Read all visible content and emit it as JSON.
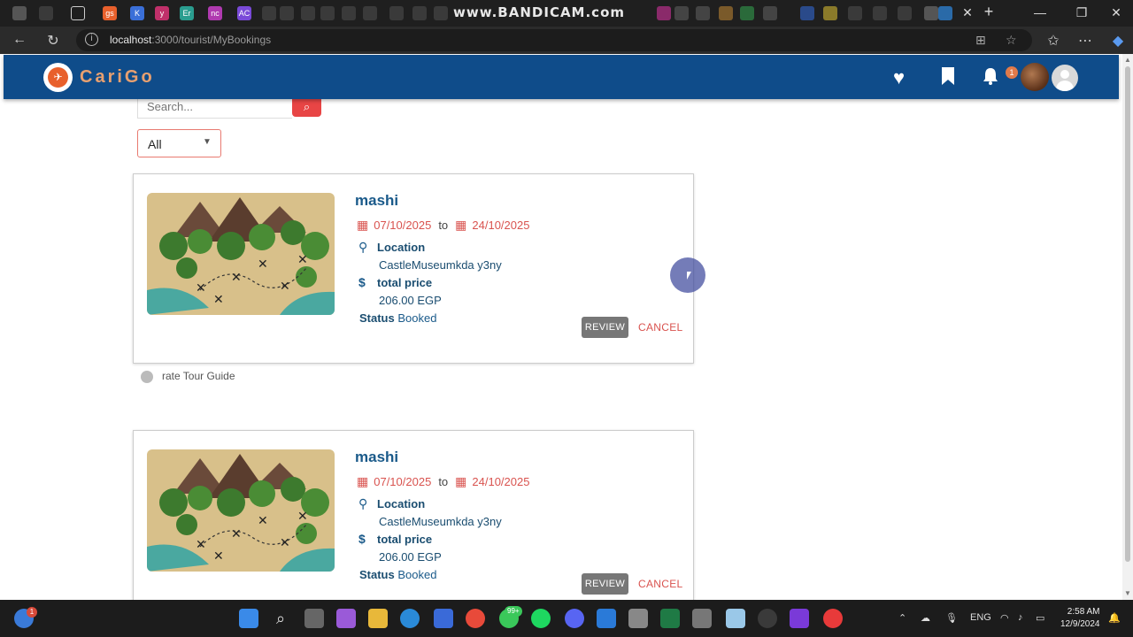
{
  "browser": {
    "watermark": "www.BANDICAM.com",
    "url_host": "localhost",
    "url_path": ":3000/tourist/MyBookings",
    "tab_labels": [
      "gs",
      "K",
      "y",
      "Er",
      "nc",
      "AC"
    ]
  },
  "app": {
    "brand": "CariGo",
    "notification_count": "1"
  },
  "search": {
    "placeholder": "Search..."
  },
  "filter": {
    "selected": "All"
  },
  "bookings": [
    {
      "title": "mashi",
      "start_date": "07/10/2025",
      "to": "to",
      "end_date": "24/10/2025",
      "location_label": "Location",
      "location": "CastleMuseumkda y3ny",
      "price_label": "total price",
      "price": "206.00 EGP",
      "status_label": "Status",
      "status": "Booked",
      "review_label": "REVIEW",
      "cancel_label": "CANCEL"
    },
    {
      "title": "mashi",
      "start_date": "07/10/2025",
      "to": "to",
      "end_date": "24/10/2025",
      "location_label": "Location",
      "location": "CastleMuseumkda y3ny",
      "price_label": "total price",
      "price": "206.00 EGP",
      "status_label": "Status",
      "status": "Booked",
      "review_label": "REVIEW",
      "cancel_label": "CANCEL"
    }
  ],
  "rate_guide_label": "rate Tour Guide",
  "taskbar": {
    "lang": "ENG",
    "time": "2:58 AM",
    "date": "12/9/2024",
    "whatsapp_badge": "99+",
    "widgets_badge": "1"
  },
  "colors": {
    "appbar": "#0f4c8a",
    "accent_red": "#d9534f",
    "title_blue": "#1a5a8a"
  }
}
